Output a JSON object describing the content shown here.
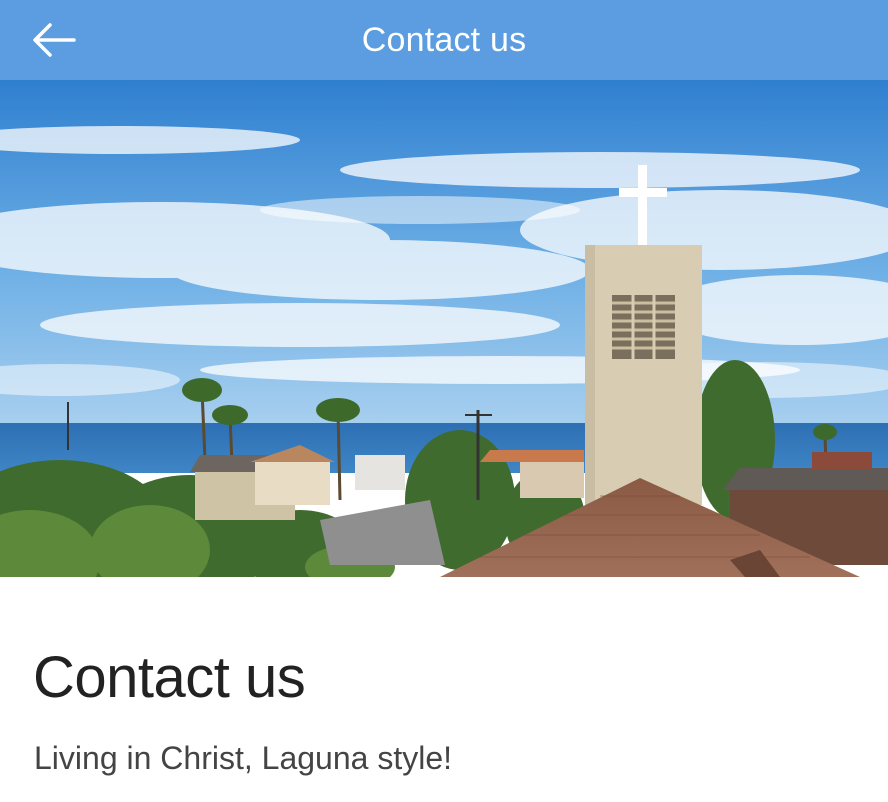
{
  "app_bar": {
    "title": "Contact us",
    "back_icon": "arrow-left-icon",
    "background_color": "#5b9de0"
  },
  "hero": {
    "description_icon": "church-tower-photo"
  },
  "content": {
    "title": "Contact us",
    "subtitle": "Living in Christ, Laguna style!"
  }
}
